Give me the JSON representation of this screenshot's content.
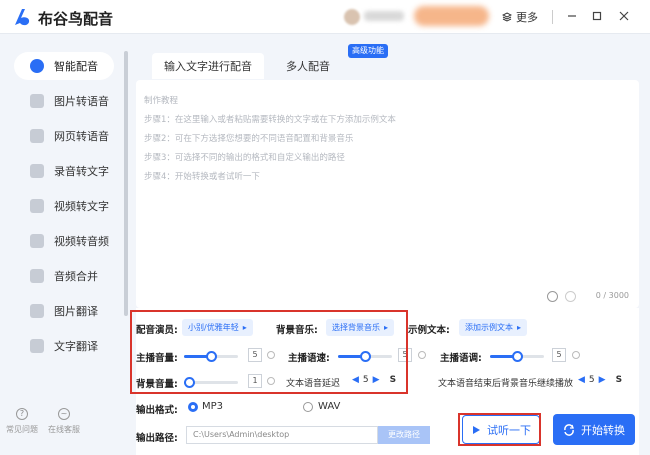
{
  "app": {
    "title": "布谷鸟配音",
    "more_label": "更多"
  },
  "sidebar": {
    "items": [
      {
        "label": "智能配音",
        "icon": "mic-icon"
      },
      {
        "label": "图片转语音",
        "icon": "image-icon"
      },
      {
        "label": "网页转语音",
        "icon": "globe-icon"
      },
      {
        "label": "录音转文字",
        "icon": "recording-icon"
      },
      {
        "label": "视频转文字",
        "icon": "video-icon"
      },
      {
        "label": "视频转音频",
        "icon": "video-audio-icon"
      },
      {
        "label": "音频合并",
        "icon": "merge-icon"
      },
      {
        "label": "图片翻译",
        "icon": "translate-image-icon"
      },
      {
        "label": "文字翻译",
        "icon": "translate-text-icon"
      }
    ],
    "bottom": {
      "faq_label": "常见问题",
      "service_label": "在线客服"
    }
  },
  "main": {
    "tabs": [
      {
        "label": "输入文字进行配音"
      },
      {
        "label": "多人配音"
      }
    ],
    "advanced_badge": "高级功能",
    "editor": {
      "lines": [
        "制作教程",
        "步骤1：在这里输入或者粘贴需要转换的文字或在下方添加示例文本",
        "步骤2：可在下方选择您想要的不同语音配置和背景音乐",
        "步骤3：可选择不同的输出的格式和自定义输出的路径",
        "步骤4：开始转换或者试听一下"
      ],
      "counter": "0 / 3000"
    }
  },
  "settings": {
    "voice_label": "配音演员:",
    "voice_value": "小别/优雅年轻",
    "bgm_label": "背景音乐:",
    "bgm_value": "选择背景音乐",
    "example_label": "示例文本:",
    "example_value": "添加示例文本",
    "host_volume_label": "主播音量:",
    "host_volume": 5,
    "host_volume_text": "5",
    "host_speed_label": "主播语速:",
    "host_speed": 5,
    "host_speed_text": "5",
    "host_pitch_label": "主播语调:",
    "host_pitch": 5,
    "host_pitch_text": "5",
    "bg_volume_label": "背景音量:",
    "bg_volume": 1,
    "bg_volume_text": "1",
    "delay_label": "文本语音延迟",
    "delay_value": "5",
    "delay_unit": "S",
    "continue_label": "文本语音结束后背景音乐继续播放",
    "continue_value": "5",
    "continue_unit": "S",
    "format_label": "输出格式:",
    "format_options": [
      "MP3",
      "WAV"
    ],
    "selected_format": "MP3",
    "path_label": "输出路径:",
    "path_value": "C:\\Users\\Admin\\desktop",
    "change_path_label": "更改路径"
  },
  "actions": {
    "preview_label": "试听一下",
    "start_label": "开始转换"
  },
  "colors": {
    "accent": "#2a6ef5",
    "highlight": "#d9342b"
  }
}
